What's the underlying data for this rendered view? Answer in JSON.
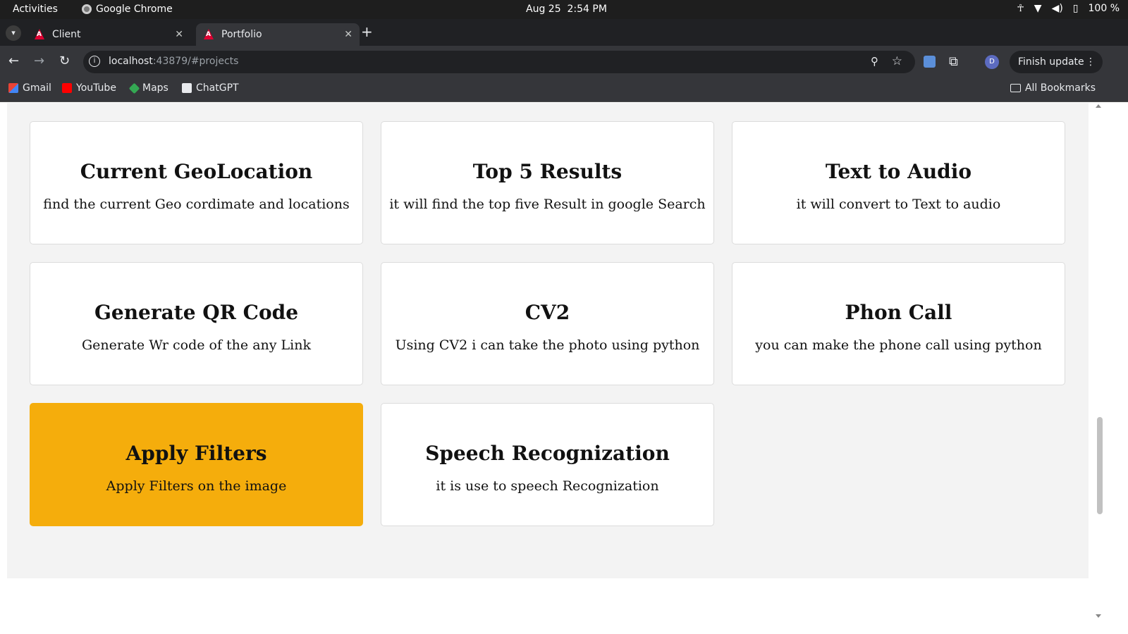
{
  "system_bar": {
    "activities": "Activities",
    "app_name": "Google Chrome",
    "date": "Aug 25",
    "time": "2:54 PM",
    "battery": "100 %"
  },
  "tabs": [
    {
      "title": "Client",
      "active": false
    },
    {
      "title": "Portfolio",
      "active": true
    }
  ],
  "toolbar": {
    "url_host": "localhost",
    "url_rest": ":43879/#projects",
    "profile_initial": "D",
    "finish_update_label": "Finish update"
  },
  "bookmarks": [
    {
      "label": "Gmail",
      "icon": "gmail-icon"
    },
    {
      "label": "YouTube",
      "icon": "youtube-icon"
    },
    {
      "label": "Maps",
      "icon": "maps-icon"
    },
    {
      "label": "ChatGPT",
      "icon": "chatgpt-icon"
    }
  ],
  "all_bookmarks_label": "All Bookmarks",
  "projects": [
    {
      "title": "Current GeoLocation",
      "description": "find the current Geo cordimate and locations",
      "highlighted": false
    },
    {
      "title": "Top 5 Results",
      "description": "it will find the top five Result in google Search",
      "highlighted": false
    },
    {
      "title": "Text to Audio",
      "description": "it will convert to Text to audio",
      "highlighted": false
    },
    {
      "title": "Generate QR Code",
      "description": "Generate Wr code of the any Link",
      "highlighted": false
    },
    {
      "title": "CV2",
      "description": "Using CV2 i can take the photo using python",
      "highlighted": false
    },
    {
      "title": "Phon Call",
      "description": "you can make the phone call using python",
      "highlighted": false
    },
    {
      "title": "Apply Filters",
      "description": "Apply Filters on the image",
      "highlighted": true
    },
    {
      "title": "Speech Recognization",
      "description": "it is use to speech Recognization",
      "highlighted": false
    }
  ],
  "colors": {
    "highlight_card": "#f5ad0c",
    "section_background": "#f3f3f3"
  }
}
